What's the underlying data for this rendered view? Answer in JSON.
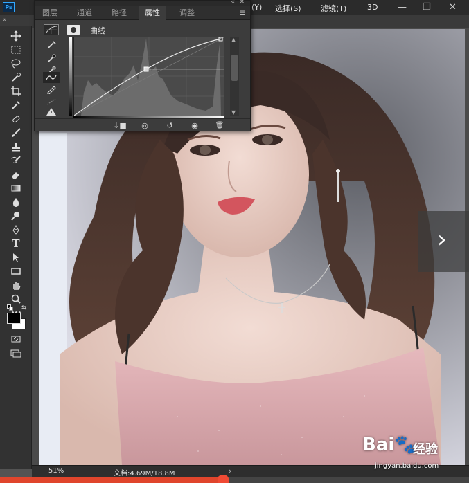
{
  "app": {
    "logo": "Ps",
    "menus": [
      "(Y)",
      "选择(S)",
      "滤镜(T)",
      "3D"
    ],
    "window_controls": {
      "minimize": "—",
      "restore": "❐",
      "close": "✕"
    },
    "toolbar_collapse": "»"
  },
  "toolbar": {
    "tools": [
      "move-tool",
      "marquee-tool",
      "lasso-tool",
      "quick-select-tool",
      "crop-tool",
      "eyedropper-tool",
      "healing-brush-tool",
      "brush-tool",
      "clone-stamp-tool",
      "history-brush-tool",
      "eraser-tool",
      "gradient-tool",
      "blur-tool",
      "dodge-tool",
      "pen-tool",
      "type-tool",
      "path-select-tool",
      "rectangle-tool",
      "hand-tool",
      "zoom-tool",
      "more-tools"
    ],
    "type_tool_glyph": "T",
    "more_glyph": "•••",
    "foreground_color": "#000000",
    "background_color": "#ffffff"
  },
  "panel": {
    "tabs": [
      "图层",
      "通道",
      "路径",
      "属性",
      "调整"
    ],
    "active_tab": "属性",
    "collapse_glyph": "«",
    "close_glyph": "✕",
    "menu_glyph": "≡",
    "adjustment_label": "曲线",
    "scroll_up": "▲",
    "scroll_down": "▼",
    "footer": {
      "clip": "↓■",
      "view_previous": "◎",
      "reset": "↺",
      "visibility": "◉",
      "delete": "🗑"
    }
  },
  "status": {
    "zoom": "51%",
    "doc_info": "文档:4.69M/18.8M",
    "arrow": "›"
  },
  "video_progress": 0.475,
  "overlay": {
    "next_arrow": "›"
  },
  "watermark": {
    "brand": "Bai🐾",
    "brand_cn": "经验",
    "url": "jingyan.baidu.com"
  },
  "colors": {
    "accent": "#31a8ff",
    "progress": "#e0452c"
  }
}
